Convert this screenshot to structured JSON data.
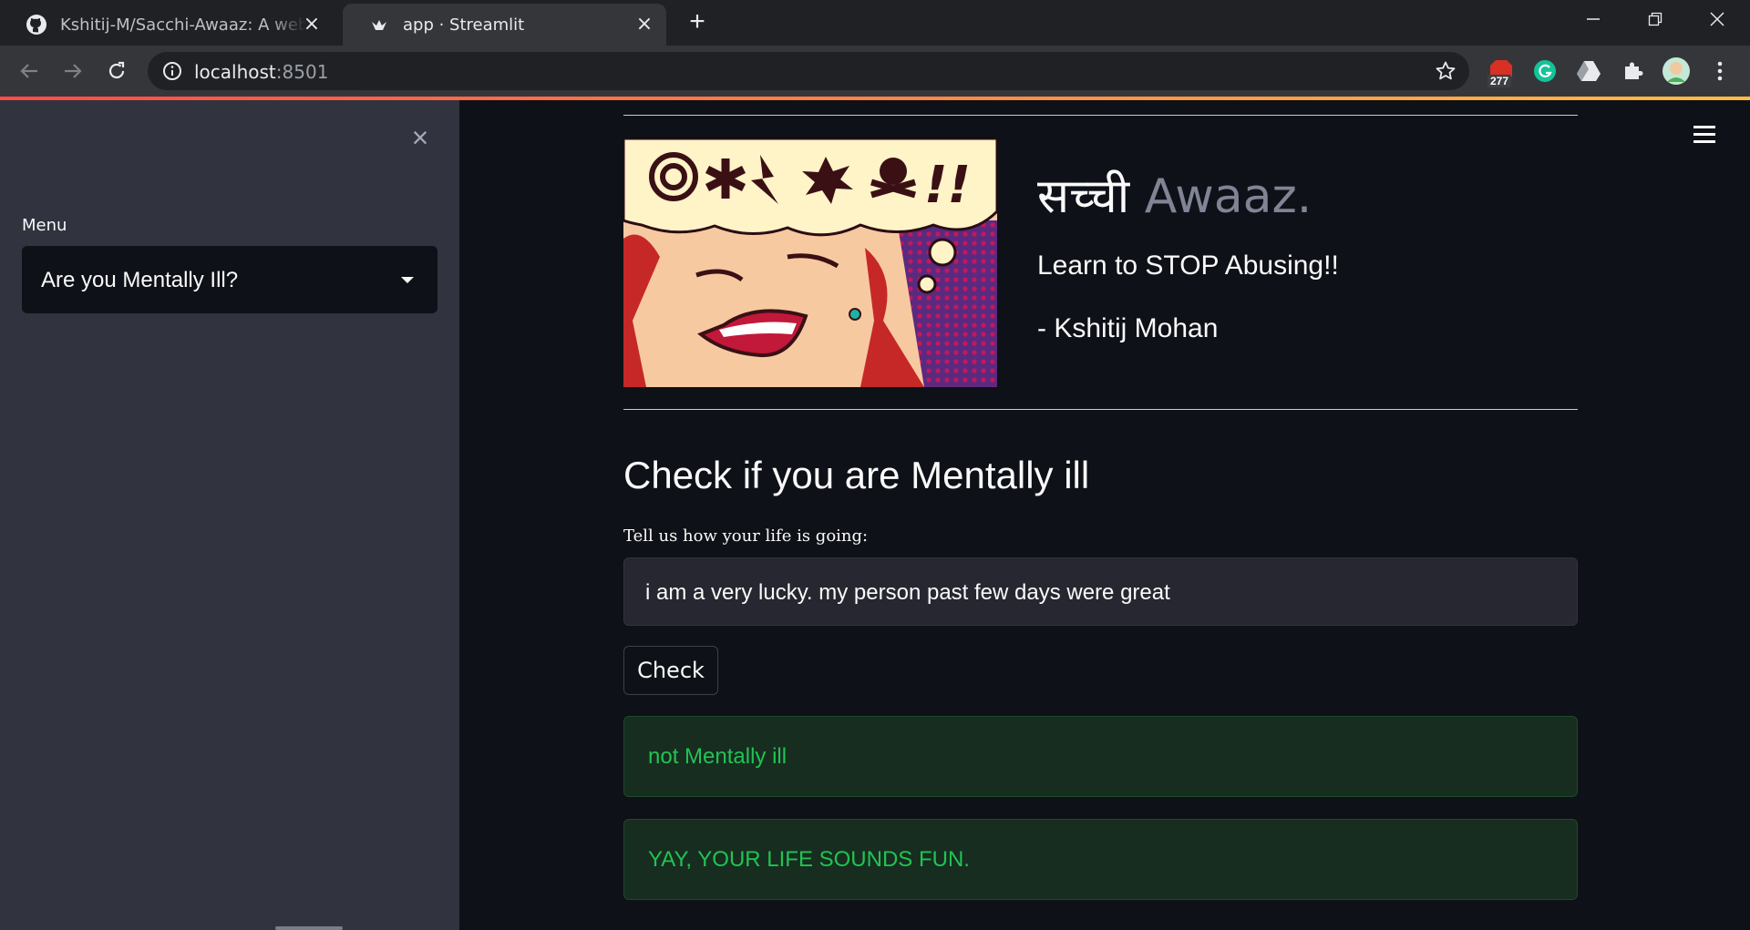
{
  "browser": {
    "tabs": [
      {
        "title": "Kshitij-M/Sacchi-Awaaz: A web ap",
        "icon": "github-icon"
      },
      {
        "title": "app · Streamlit",
        "icon": "streamlit-icon"
      }
    ],
    "url_host": "localhost",
    "url_port": ":8501",
    "extension_badge": "277"
  },
  "sidebar": {
    "menu_label": "Menu",
    "selected_option": "Are you Mentally Ill?"
  },
  "header": {
    "title_hindi": "सच्ची",
    "title_english": " Awaaz.",
    "subtitle": "Learn to STOP Abusing!!",
    "author": "- Kshitij Mohan",
    "bubble_symbols": "!!"
  },
  "main": {
    "section_title": "Check if you are Mentally ill",
    "input_label": "Tell us how your life is going:",
    "input_value": "i am a very lucky. my person past few days were great",
    "check_button": "Check",
    "result_1": "not Mentally ill",
    "result_2": "YAY, YOUR LIFE SOUNDS FUN."
  },
  "colors": {
    "accent_gradient_start": "#ff4b4b",
    "accent_gradient_end": "#ffbd45",
    "success_text": "#21c354",
    "success_bg": "#172d1f"
  }
}
